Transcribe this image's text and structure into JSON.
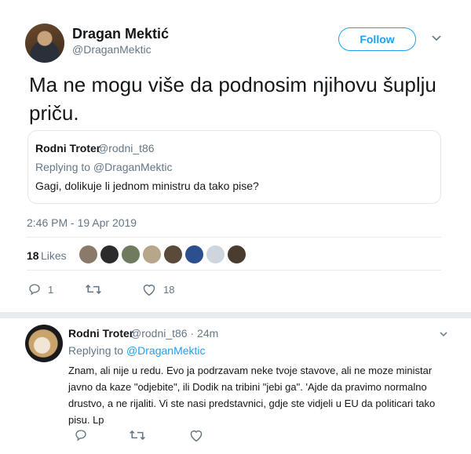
{
  "tweet": {
    "author_name": "Dragan Mektić",
    "author_handle": "@DraganMektic",
    "follow_label": "Follow",
    "text": "Ma ne mogu više da podnosim njihovu šuplju priču.",
    "timestamp": "2:46 PM - 19 Apr 2019",
    "likes_count": "18",
    "likes_label": "Likes",
    "reply_count": "1",
    "retweet_count": "",
    "like_count": "18",
    "quote": {
      "author_name": "Rodni Troter",
      "author_handle": "@rodni_t86",
      "replying_to": "Replying to @DraganMektic",
      "text": "Gagi, dolikuje li jednom ministru da tako pise?"
    }
  },
  "likers_colors": [
    "#8a7a6a",
    "#2b2b2b",
    "#6f7a5e",
    "#b8a68a",
    "#5a4a3a",
    "#2e4f8f",
    "#cdd6dd",
    "#4a3c2e"
  ],
  "reply": {
    "author_name": "Rodni Troter",
    "author_handle": "@rodni_t86 · 24m",
    "replying_prefix": "Replying to",
    "replying_to": "@DraganMektic",
    "text": "Znam, ali nije u redu. Evo ja podrzavam neke tvoje stavove, ali ne moze ministar javno da kaze \"odjebite\", ili Dodik na tribini \"jebi ga\". 'Ajde da pravimo normalno drustvo, a ne rijaliti. Vi ste nasi predstavnici, gdje ste vidjeli u EU da politicari tako pisu. Lp"
  },
  "colors": {
    "accent": "#1da1f2",
    "muted": "#657786",
    "text": "#14171a",
    "divider": "#e6ecf0"
  }
}
